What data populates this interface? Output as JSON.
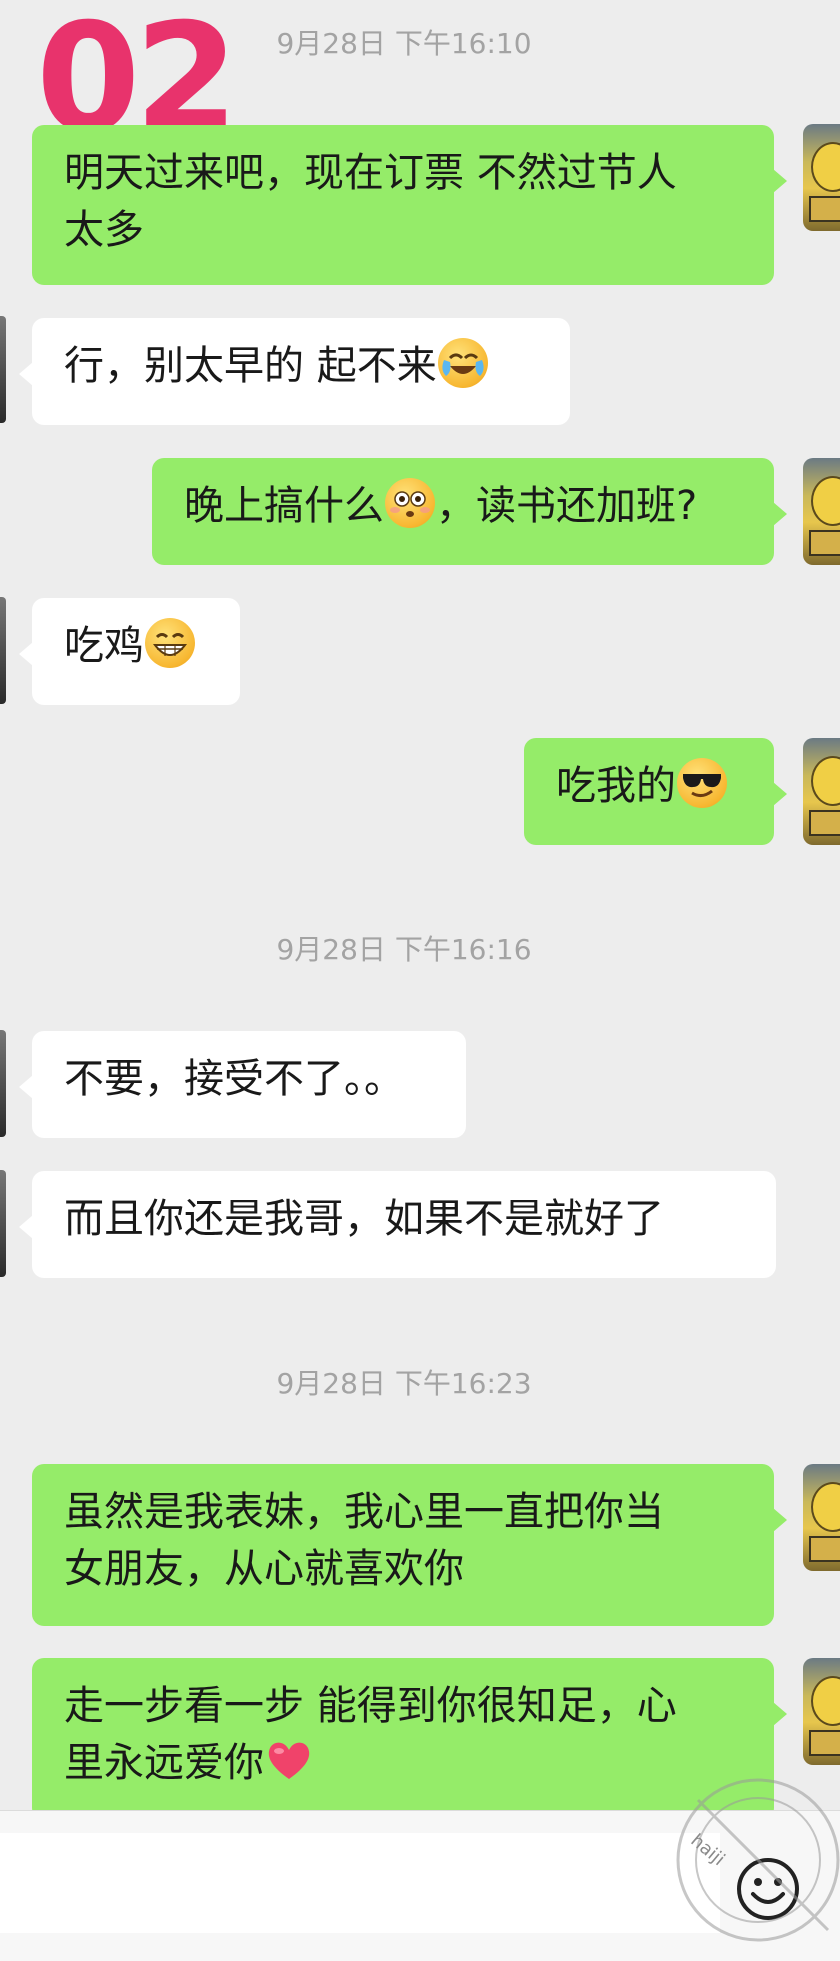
{
  "badge": "02",
  "timestamps": [
    "9月28日 下午16:10",
    "9月28日 下午16:16",
    "9月28日 下午16:23"
  ],
  "messages": [
    {
      "side": "right",
      "text": "明天过来吧，现在订票 不然过节人",
      "text2": "太多"
    },
    {
      "side": "left",
      "text": "行，别太早的  起不来",
      "emoji": "face-with-tears-of-joy-icon"
    },
    {
      "side": "right",
      "text": "晚上搞什么",
      "emoji": "flushed-face-icon",
      "text2": "，读书还加班?"
    },
    {
      "side": "left",
      "text": "吃鸡",
      "emoji": "grinning-face-icon"
    },
    {
      "side": "right",
      "text": "吃我的",
      "emoji": "smiling-face-with-sunglasses-icon"
    },
    {
      "side": "left",
      "text": "不要，接受不了。。"
    },
    {
      "side": "left",
      "text": "而且你还是我哥，如果不是就好了"
    },
    {
      "side": "right",
      "text": "虽然是我表妹，我心里一直把你当",
      "text2": "女朋友，从心就喜欢你"
    },
    {
      "side": "right",
      "text": "走一步看一步  能得到你很知足，心",
      "text2": "里永远爱你",
      "emoji": "red-heart-icon"
    }
  ],
  "watermark": "haiji",
  "colors": {
    "sent_bubble": "#95ec69",
    "received_bubble": "#ffffff",
    "background": "#ededed",
    "badge": "#e8336c"
  }
}
